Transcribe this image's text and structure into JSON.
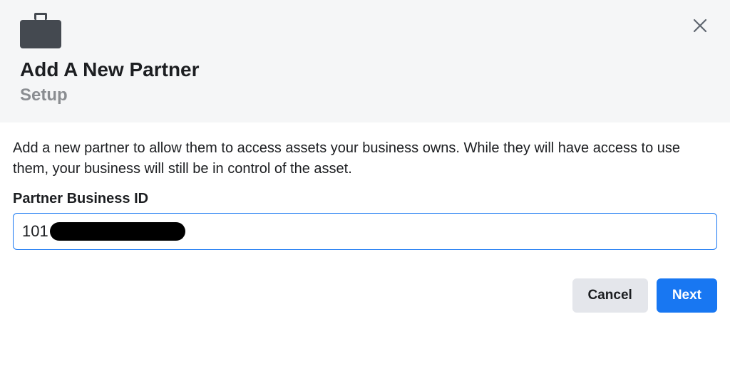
{
  "header": {
    "title": "Add A New Partner",
    "subtitle": "Setup"
  },
  "body": {
    "description": "Add a new partner to allow them to access assets your business owns. While they will have access to use them, your business will still be in control of the asset.",
    "field_label": "Partner Business ID",
    "input_value_visible": "101"
  },
  "footer": {
    "cancel_label": "Cancel",
    "next_label": "Next"
  }
}
